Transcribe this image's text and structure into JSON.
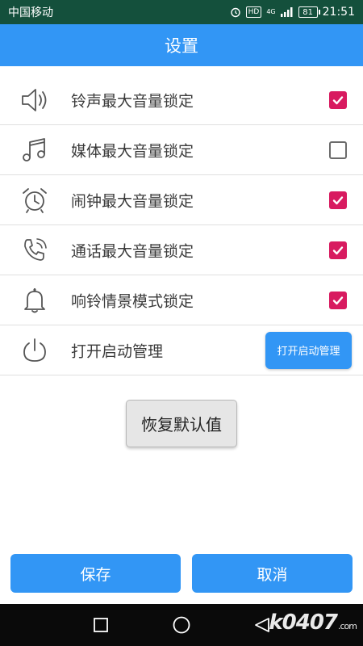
{
  "status_bar": {
    "carrier": "中国移动",
    "hd_badge": "HD",
    "network_badge": "4G",
    "battery": "81",
    "time": "21:51"
  },
  "app_bar": {
    "title": "设置"
  },
  "settings": {
    "items": [
      {
        "label": "铃声最大音量锁定",
        "icon": "speaker-icon",
        "checked": true
      },
      {
        "label": "媒体最大音量锁定",
        "icon": "music-note-icon",
        "checked": false
      },
      {
        "label": "闹钟最大音量锁定",
        "icon": "alarm-clock-icon",
        "checked": true
      },
      {
        "label": "通话最大音量锁定",
        "icon": "phone-icon",
        "checked": true
      },
      {
        "label": "响铃情景模式锁定",
        "icon": "bell-icon",
        "checked": true
      },
      {
        "label": "打开启动管理",
        "icon": "power-icon",
        "button_label": "打开启动管理"
      }
    ]
  },
  "actions": {
    "restore_label": "恢复默认值",
    "save_label": "保存",
    "cancel_label": "取消"
  },
  "watermark": {
    "text": "k0407",
    "suffix": ".com"
  },
  "colors": {
    "status_bar": "#14503c",
    "primary": "#3296f5",
    "checkbox_checked": "#d81b60",
    "nav_bar": "#0a0a0a"
  }
}
